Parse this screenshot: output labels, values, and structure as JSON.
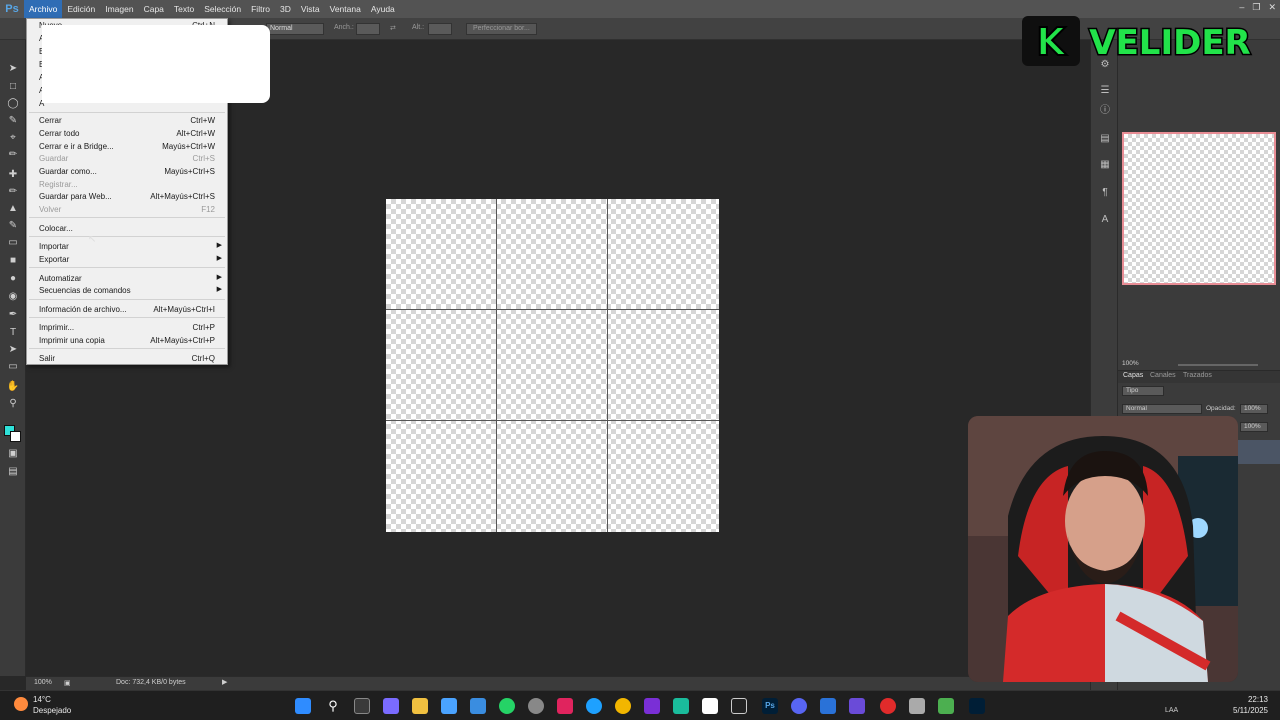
{
  "app": {
    "logo": "Ps"
  },
  "menubar": {
    "items": [
      "Archivo",
      "Edición",
      "Imagen",
      "Capa",
      "Texto",
      "Selección",
      "Filtro",
      "3D",
      "Vista",
      "Ventana",
      "Ayuda"
    ]
  },
  "optionsbar": {
    "mode_value": "Normal",
    "width_label": "Anch.:",
    "height_label": "Alt.:",
    "refine_button": "Perfeccionar bor..."
  },
  "file_menu": {
    "partial_top": [
      "Nuevo...",
      "Ctrl+N"
    ],
    "partial_letters": [
      "A",
      "E",
      "E",
      "A",
      "A",
      "A"
    ],
    "items": [
      {
        "label": "Cerrar",
        "shortcut": "Ctrl+W",
        "disabled": false
      },
      {
        "label": "Cerrar todo",
        "shortcut": "Alt+Ctrl+W",
        "disabled": false
      },
      {
        "label": "Cerrar e ir a Bridge...",
        "shortcut": "Mayús+Ctrl+W",
        "disabled": false
      },
      {
        "label": "Guardar",
        "shortcut": "Ctrl+S",
        "disabled": true
      },
      {
        "label": "Guardar como...",
        "shortcut": "Mayús+Ctrl+S",
        "disabled": false
      },
      {
        "label": "Registrar...",
        "shortcut": "",
        "disabled": true
      },
      {
        "label": "Guardar para Web...",
        "shortcut": "Alt+Mayús+Ctrl+S",
        "disabled": false
      },
      {
        "label": "Volver",
        "shortcut": "F12",
        "disabled": true
      },
      {
        "label": "Colocar...",
        "shortcut": "",
        "disabled": false
      },
      {
        "label": "Importar",
        "shortcut": "",
        "disabled": false,
        "submenu": true
      },
      {
        "label": "Exportar",
        "shortcut": "",
        "disabled": false,
        "submenu": true
      },
      {
        "label": "Automatizar",
        "shortcut": "",
        "disabled": false,
        "submenu": true
      },
      {
        "label": "Secuencias de comandos",
        "shortcut": "",
        "disabled": false,
        "submenu": true
      },
      {
        "label": "Información de archivo...",
        "shortcut": "Alt+Mayús+Ctrl+I",
        "disabled": false
      },
      {
        "label": "Imprimir...",
        "shortcut": "Ctrl+P",
        "disabled": false
      },
      {
        "label": "Imprimir una copia",
        "shortcut": "Alt+Mayús+Ctrl+P",
        "disabled": false
      },
      {
        "label": "Salir",
        "shortcut": "Ctrl+Q",
        "disabled": false
      }
    ]
  },
  "statusbar": {
    "zoom": "100%",
    "doc_info": "Doc: 732,4 KB/0 bytes"
  },
  "navigator": {
    "zoom": "100%"
  },
  "layers_panel": {
    "tabs": [
      "Capas",
      "Canales",
      "Trazados"
    ],
    "filter_label": "Tipo",
    "blend_mode": "Normal",
    "opacity_label": "Opacidad:",
    "opacity_value": "100%",
    "fill_value": "100%"
  },
  "brand": {
    "text": "VELIDER",
    "k_letter": "K"
  },
  "taskbar": {
    "weather_temp": "14°C",
    "weather_desc": "Despejado",
    "lang": "LAA",
    "time": "22:13",
    "date": "5/11/2025"
  },
  "colors": {
    "foreground": "#2fe1d9",
    "background": "#ffffff",
    "menu_highlight": "#2f6db5",
    "brand_green": "#22e34a"
  }
}
